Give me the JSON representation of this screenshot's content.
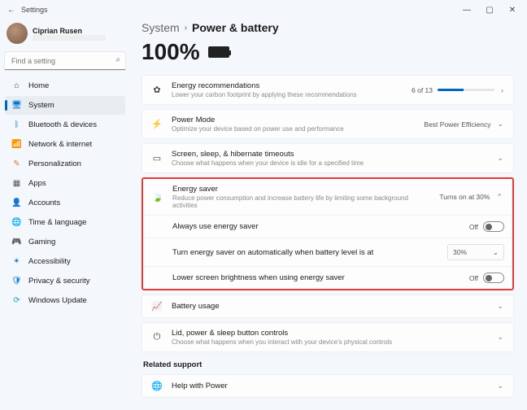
{
  "window": {
    "title": "Settings"
  },
  "profile": {
    "name": "Ciprian Rusen"
  },
  "search": {
    "placeholder": "Find a setting"
  },
  "sidebar": {
    "items": [
      {
        "label": "Home"
      },
      {
        "label": "System"
      },
      {
        "label": "Bluetooth & devices"
      },
      {
        "label": "Network & internet"
      },
      {
        "label": "Personalization"
      },
      {
        "label": "Apps"
      },
      {
        "label": "Accounts"
      },
      {
        "label": "Time & language"
      },
      {
        "label": "Gaming"
      },
      {
        "label": "Accessibility"
      },
      {
        "label": "Privacy & security"
      },
      {
        "label": "Windows Update"
      }
    ]
  },
  "breadcrumb": {
    "parent": "System",
    "page": "Power & battery"
  },
  "battery": {
    "percent": "100%"
  },
  "cards": {
    "energy_rec": {
      "title": "Energy recommendations",
      "desc": "Lower your carbon footprint by applying these recommendations",
      "count": "6 of 13"
    },
    "power_mode": {
      "title": "Power Mode",
      "desc": "Optimize your device based on power use and performance",
      "value": "Best Power Efficiency"
    },
    "screen_sleep": {
      "title": "Screen, sleep, & hibernate timeouts",
      "desc": "Choose what happens when your device is idle for a specified time"
    },
    "energy_saver": {
      "title": "Energy saver",
      "desc": "Reduce power consumption and increase battery life by limiting some background activities",
      "status": "Turns on at 30%",
      "always": {
        "label": "Always use energy saver",
        "state": "Off"
      },
      "auto": {
        "label": "Turn energy saver on automatically when battery level is at",
        "value": "30%"
      },
      "brightness": {
        "label": "Lower screen brightness when using energy saver",
        "state": "Off"
      }
    },
    "battery_usage": {
      "title": "Battery usage"
    },
    "lid": {
      "title": "Lid, power & sleep button controls",
      "desc": "Choose what happens when you interact with your device's physical controls"
    }
  },
  "related": {
    "heading": "Related support",
    "help": "Help with Power"
  }
}
